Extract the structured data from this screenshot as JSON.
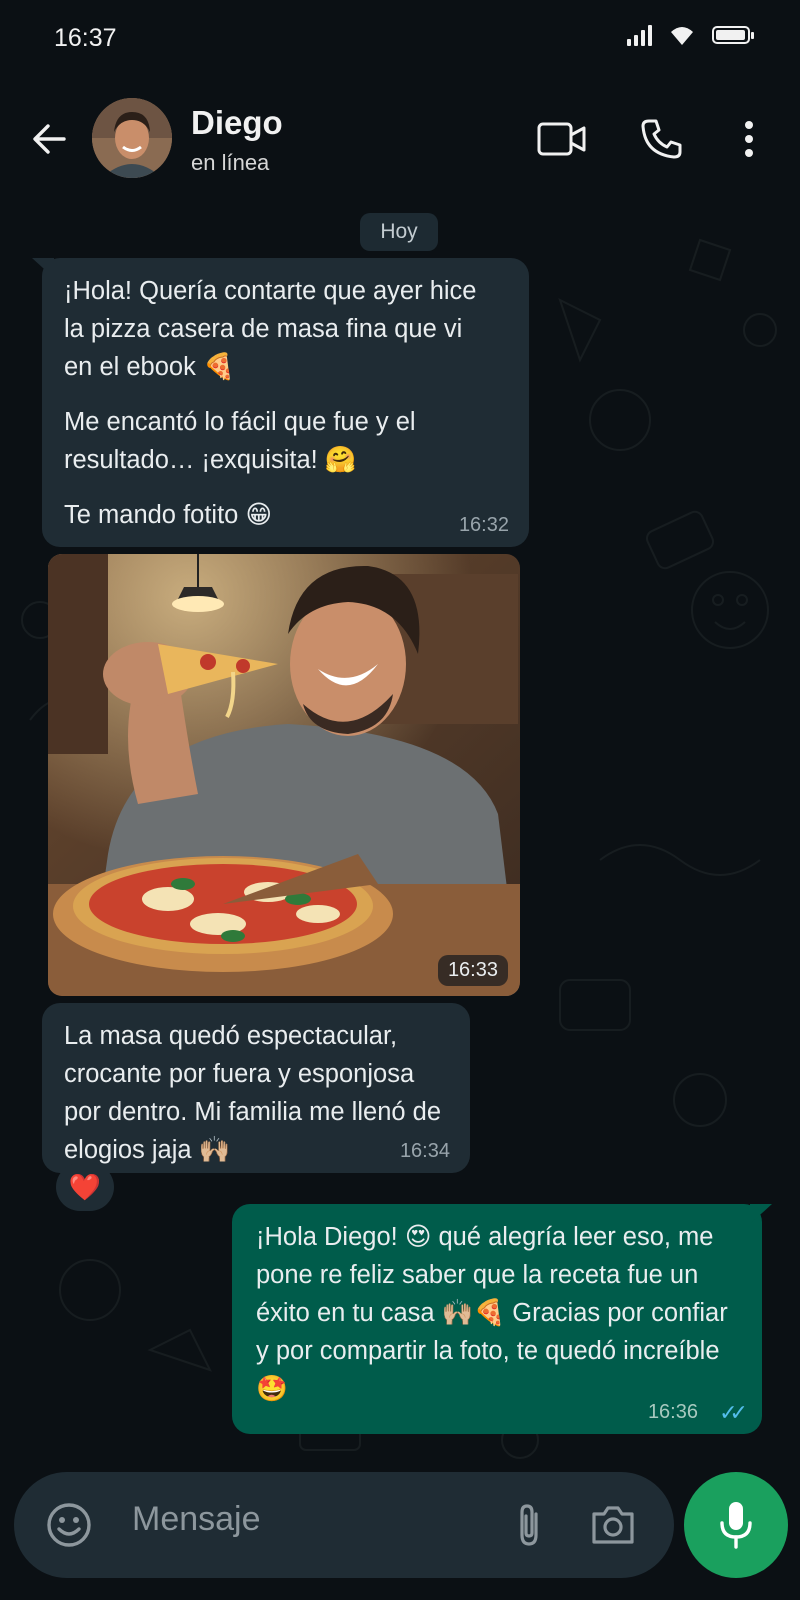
{
  "status_bar": {
    "time": "16:37"
  },
  "header": {
    "contact_name": "Diego",
    "contact_status": "en línea"
  },
  "chat": {
    "date_chip": "Hoy",
    "messages": [
      {
        "direction": "incoming",
        "paragraphs": [
          "¡Hola! Quería contarte que ayer hice la pizza casera de masa fina que vi en el ebook 🍕",
          "Me encantó lo fácil que fue y el resultado… ¡exquisita! 🤗",
          "Te mando fotito 😁"
        ],
        "time": "16:32"
      },
      {
        "direction": "incoming",
        "type": "photo",
        "time": "16:33"
      },
      {
        "direction": "incoming",
        "text": "La masa quedó espectacular, crocante por fuera y esponjosa por dentro. Mi familia me llenó de elogios jaja 🙌🏼",
        "time": "16:34",
        "reaction": "❤️"
      },
      {
        "direction": "outgoing",
        "text": "¡Hola Diego! 😍 qué alegría leer eso, me pone re feliz saber que la receta fue un éxito en tu casa 🙌🏼🍕 Gracias por confiar y por compartir la foto, te quedó increíble 🤩",
        "time": "16:36",
        "read_ticks": "✓✓"
      }
    ]
  },
  "composer": {
    "placeholder": "Mensaje"
  },
  "colors": {
    "background": "#0b1014",
    "incoming_bubble": "#1f2c34",
    "outgoing_bubble": "#005c4b",
    "mic_button": "#1aa05e",
    "read_ticks": "#53bdeb"
  }
}
